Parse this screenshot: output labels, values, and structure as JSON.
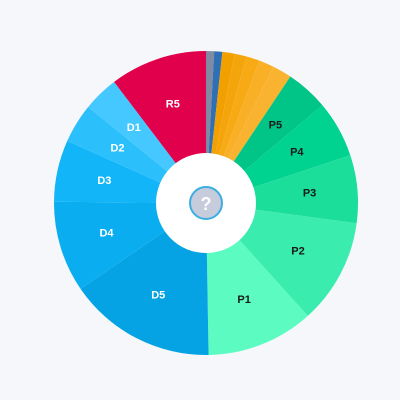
{
  "chart_data": {
    "type": "pie",
    "donut": true,
    "start_angle_deg": 0,
    "direction": "clockwise",
    "slices": [
      {
        "label": "",
        "value": 0.8,
        "color": "#808aa3",
        "label_color": "#ffffff"
      },
      {
        "label": "",
        "value": 0.8,
        "color": "#2f6fb3",
        "label_color": "#ffffff"
      },
      {
        "label": "",
        "value": 1.2,
        "color": "#f2a000",
        "label_color": "#ffffff"
      },
      {
        "label": "",
        "value": 1.2,
        "color": "#f5a50c",
        "label_color": "#ffffff"
      },
      {
        "label": "",
        "value": 1.3,
        "color": "#f7aa14",
        "label_color": "#ffffff"
      },
      {
        "label": "",
        "value": 1.5,
        "color": "#f9b026",
        "label_color": "#ffffff"
      },
      {
        "label": "",
        "value": 1.9,
        "color": "#fab331",
        "label_color": "#ffffff"
      },
      {
        "label": "P5",
        "value": 4.2,
        "color": "#00c587",
        "label_color": "#1a1a1a"
      },
      {
        "label": "P4",
        "value": 5.6,
        "color": "#00d28f",
        "label_color": "#1a1a1a"
      },
      {
        "label": "P3",
        "value": 6.7,
        "color": "#1ade9a",
        "label_color": "#1a1a1a"
      },
      {
        "label": "P2",
        "value": 10.4,
        "color": "#3aecad",
        "label_color": "#1a1a1a"
      },
      {
        "label": "P1",
        "value": 10.6,
        "color": "#5bfbc2",
        "label_color": "#1a1a1a"
      },
      {
        "label": "D5",
        "value": 14.6,
        "color": "#06a3e4",
        "label_color": "#ffffff"
      },
      {
        "label": "D4",
        "value": 9.0,
        "color": "#0aaef0",
        "label_color": "#ffffff"
      },
      {
        "label": "D3",
        "value": 6.1,
        "color": "#12b6f8",
        "label_color": "#ffffff"
      },
      {
        "label": "D2",
        "value": 3.9,
        "color": "#2bc0fc",
        "label_color": "#ffffff"
      },
      {
        "label": "D1",
        "value": 3.5,
        "color": "#44c8ff",
        "label_color": "#ffffff"
      },
      {
        "label": "R5",
        "value": 9.6,
        "color": "#e0004b",
        "label_color": "#ffffff"
      }
    ]
  },
  "center": {
    "help_text": "?",
    "bg_color": "#ffffff",
    "badge_fill": "#c7ccdd",
    "badge_stroke": "#3aaee0"
  }
}
